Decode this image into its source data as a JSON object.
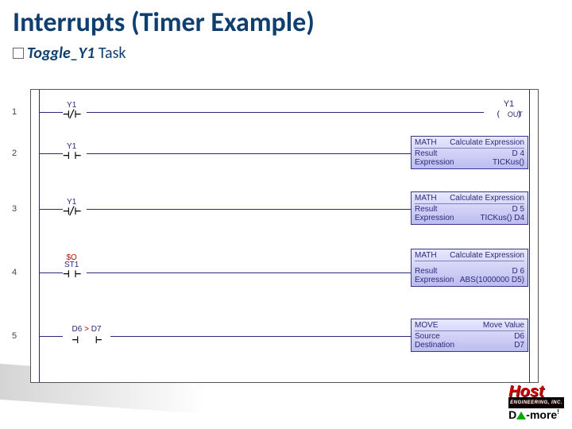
{
  "title": "Interrupts (Timer Example)",
  "subtitle_italic": "Toggle_Y1",
  "subtitle_rest": " Task",
  "rungs": [
    {
      "n": "1"
    },
    {
      "n": "2"
    },
    {
      "n": "3"
    },
    {
      "n": "4"
    },
    {
      "n": "5"
    }
  ],
  "contacts": {
    "y1": "Y1",
    "so": "$O",
    "st1": "ST1",
    "d6": "D6",
    "d7": "D7",
    "gt": ">"
  },
  "coil": {
    "label": "Y1",
    "sub": "OUT"
  },
  "boxes": {
    "math_label": "MATH",
    "math_sub": "Calculate Expression",
    "result": "Result",
    "expr": "Expression",
    "d4": "D 4",
    "tick": "TICKus()",
    "d5": "D 5",
    "tick_d4": "TICKus()   D4",
    "d6": "D 6",
    "abs": "ABS(1000000   D5)",
    "move": "MOVE",
    "move_sub": "Move Value",
    "source": "Source",
    "dest": "Destination",
    "d6v": "D6",
    "d7v": "D7"
  },
  "logo": {
    "host": "Host",
    "eng": "ENGINEERING, INC.",
    "domore": "Do-more"
  }
}
